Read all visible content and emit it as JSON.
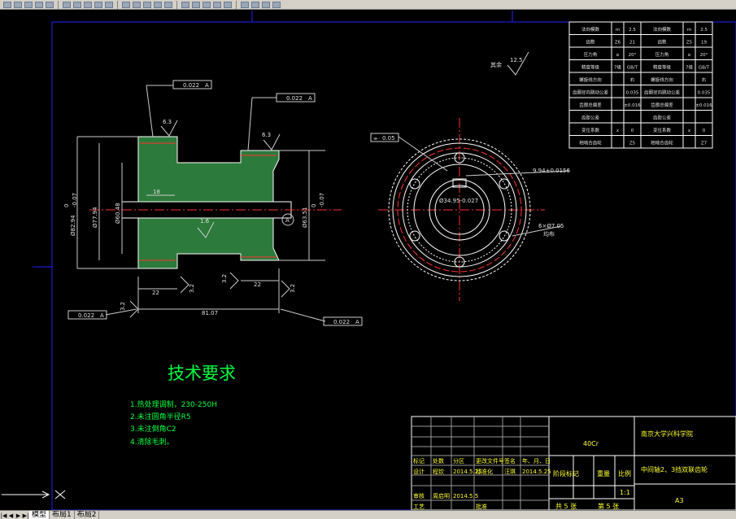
{
  "toolbar": {
    "buttons": 28
  },
  "tech": {
    "heading": "技术要求",
    "items": [
      "1.热处理调制，230-250H",
      "2.未注圆角半径R5",
      "3.未注倒角C2",
      "4.清除毛刺。"
    ]
  },
  "param_table": {
    "rows": [
      [
        "法向模数",
        "m",
        "2.5",
        "法向模数",
        "m",
        "2.5"
      ],
      [
        "齿数",
        "Z6",
        "21",
        "齿数",
        "Z5",
        "19"
      ],
      [
        "压力角",
        "α",
        "20°",
        "压力角",
        "α",
        "20°"
      ],
      [
        "精度等级",
        "7级",
        "GB/T",
        "精度等级",
        "7级",
        "GB/T"
      ],
      [
        "螺旋线方向",
        "",
        "右",
        "螺旋线方向",
        "",
        "右"
      ],
      [
        "齿圈径向跳动公差",
        "",
        "0.035",
        "齿圈径向跳动公差",
        "",
        "0.035"
      ],
      [
        "齿廓总偏差",
        "",
        "±0.016",
        "齿廓总偏差",
        "",
        "±0.016"
      ],
      [
        "齿距公差",
        "",
        "",
        "齿距公差",
        "",
        "",
        ""
      ],
      [
        "变位系数",
        "x",
        "0",
        "变位系数",
        "x",
        "0"
      ],
      [
        "相啮合齿轮",
        "",
        "Z5",
        "相啮合齿轮",
        "",
        "Z7"
      ]
    ]
  },
  "title_block": {
    "material": "40Cr",
    "school": "南京大学兴科学院",
    "part_name": "中间轴2、3挡双联齿轮",
    "scale": "1:1",
    "sheet_size": "A3",
    "total_sheets": "共 5 张",
    "sheet_no": "第 5 张",
    "stage_mark": "阶段标记",
    "weight": "重量",
    "scale_label": "比例",
    "rows": [
      [
        "标记",
        "处数",
        "分区",
        "更改文件号",
        "签名",
        "年、月、日"
      ],
      [
        "设计",
        "程钦",
        "2014.5.25",
        "标准化",
        "汪琪",
        "2014.5.25"
      ],
      [
        "审核",
        "周启明",
        "2014.5.5",
        "",
        "",
        ""
      ],
      [
        "工艺",
        "",
        "",
        "批准",
        "",
        ""
      ]
    ]
  },
  "dims": {
    "tol_1": "0.022",
    "datum": "A",
    "tol_2": "0.022",
    "tol_3": "0.022",
    "tol_4": "0.022",
    "flat": "0.05",
    "rough_63a": "6.3",
    "rough_63b": "6.3",
    "rough_16": "1.6",
    "rough_125": "12.5",
    "rough_32a": "3.2",
    "rough_32b": "3.2",
    "rough_32c": "3.2",
    "rough_32d": "3.2",
    "other_label": "其余",
    "len_18": "18",
    "len_22a": "22",
    "len_22b": "22",
    "len_22c": "22",
    "len_8107": "81.07",
    "dia_a": "Ø82.94",
    "dia_b": "Ø77.94",
    "dia_c": "Ø60.48",
    "dia_d": "Ø63.51",
    "tol_0": "0",
    "tol_m007": "-0.07",
    "keyway": "9.94±0.0156",
    "bore": "Ø34.95-0.027",
    "holes": "6×Ø7.05",
    "holes_sub": "均布"
  },
  "tabs": [
    "模型",
    "布局1",
    "布局2"
  ]
}
